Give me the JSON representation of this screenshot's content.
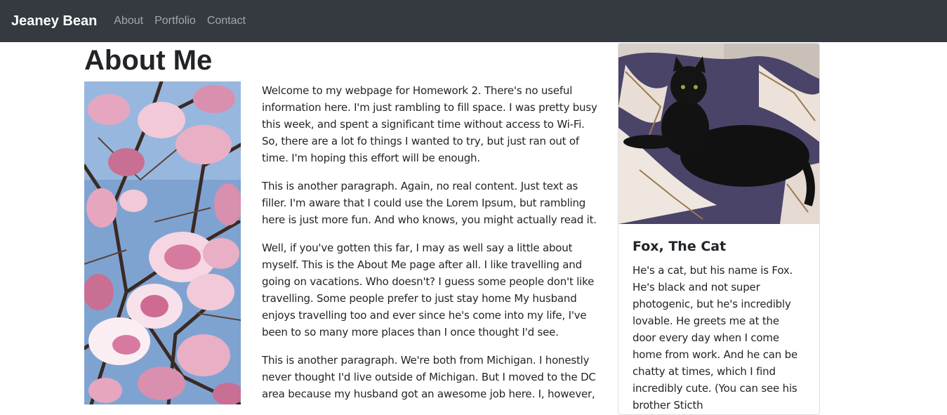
{
  "navbar": {
    "brand": "Jeaney Bean",
    "links": [
      "About",
      "Portfolio",
      "Contact"
    ],
    "background": "#343a40"
  },
  "main": {
    "title": "About Me",
    "paragraphs": [
      "Welcome to my webpage for Homework 2. There's no useful information here. I'm just rambling to fill space. I was pretty busy this week, and spent a significant time without access to Wi-Fi. So, there are a lot fo things I wanted to try, but just ran out of time. I'm hoping this effort will be enough.",
      "This is another paragraph. Again, no real content. Just text as filler. I'm aware that I could use the Lorem Ipsum, but rambling here is just more fun. And who knows, you might actually read it.",
      "Well, if you've gotten this far, I may as well say a little about myself. This is the About Me page after all. I like travelling and going on vacations. Who doesn't? I guess some people don't like travelling. Some people prefer to just stay home My husband enjoys travelling too and ever since he's come into my life, I've been to so many more places than I once thought I'd see.",
      "This is another paragraph. We're both from Michigan. I honestly never thought I'd live outside of Michigan. But I moved to the DC area because my husband got an awesome job here. I, however,"
    ]
  },
  "card": {
    "title": "Fox, The Cat",
    "text": "He's a cat, but his name is Fox. He's black and not super photogenic, but he's incredibly lovable. He greets me at the door every day when I come home from work. And he can be chatty at times, which I find incredibly cute. (You can see his brother Sticth"
  }
}
